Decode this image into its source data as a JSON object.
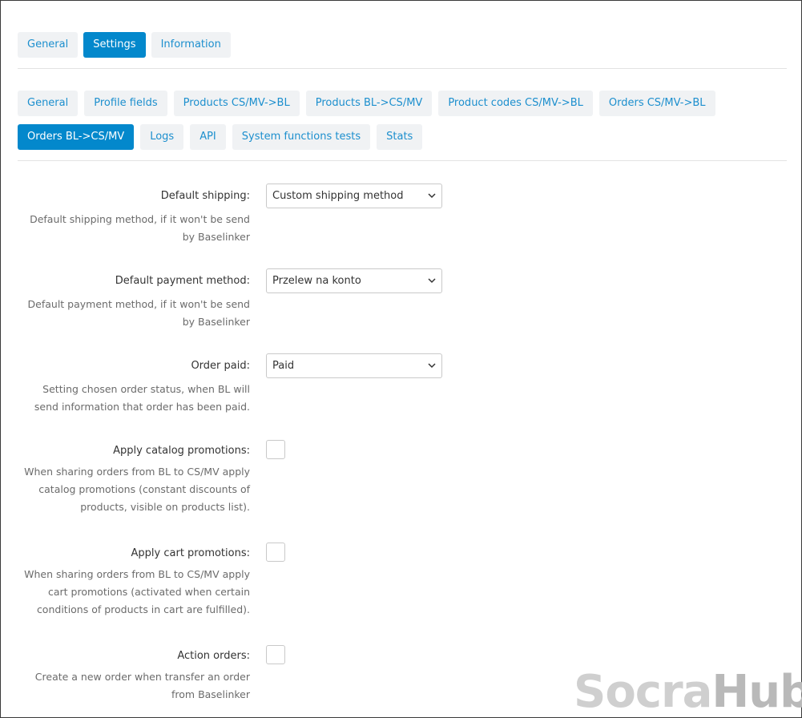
{
  "top_tabs": [
    {
      "label": "General",
      "active": false
    },
    {
      "label": "Settings",
      "active": true
    },
    {
      "label": "Information",
      "active": false
    }
  ],
  "sub_tabs": [
    {
      "label": "General",
      "active": false
    },
    {
      "label": "Profile fields",
      "active": false
    },
    {
      "label": "Products CS/MV->BL",
      "active": false
    },
    {
      "label": "Products BL->CS/MV",
      "active": false
    },
    {
      "label": "Product codes CS/MV->BL",
      "active": false
    },
    {
      "label": "Orders CS/MV->BL",
      "active": false
    },
    {
      "label": "Orders BL->CS/MV",
      "active": true
    },
    {
      "label": "Logs",
      "active": false
    },
    {
      "label": "API",
      "active": false
    },
    {
      "label": "System functions tests",
      "active": false
    },
    {
      "label": "Stats",
      "active": false
    }
  ],
  "fields": {
    "default_shipping": {
      "label": "Default shipping:",
      "value": "Custom shipping method",
      "help": "Default shipping method, if it won't be send by Baselinker"
    },
    "default_payment": {
      "label": "Default payment method:",
      "value": "Przelew na konto",
      "help": "Default payment method, if it won't be send by Baselinker"
    },
    "order_paid": {
      "label": "Order paid:",
      "value": "Paid",
      "help": "Setting chosen order status, when BL will send information that order has been paid."
    },
    "apply_catalog_promotions": {
      "label": "Apply catalog promotions:",
      "checked": false,
      "help": "When sharing orders from BL to CS/MV apply catalog promotions (constant discounts of products, visible on products list)."
    },
    "apply_cart_promotions": {
      "label": "Apply cart promotions:",
      "checked": false,
      "help": "When sharing orders from BL to CS/MV apply cart promotions (activated when certain conditions of products in cart are fulfilled)."
    },
    "action_orders": {
      "label": "Action orders:",
      "checked": false,
      "help": "Create a new order when transfer an order from Baselinker"
    }
  },
  "watermark": {
    "part1": "Socra",
    "part2": "Hub"
  },
  "colors": {
    "accent": "#0388cc",
    "link": "#1c8fce",
    "tab_bg": "#f0f2f4"
  }
}
